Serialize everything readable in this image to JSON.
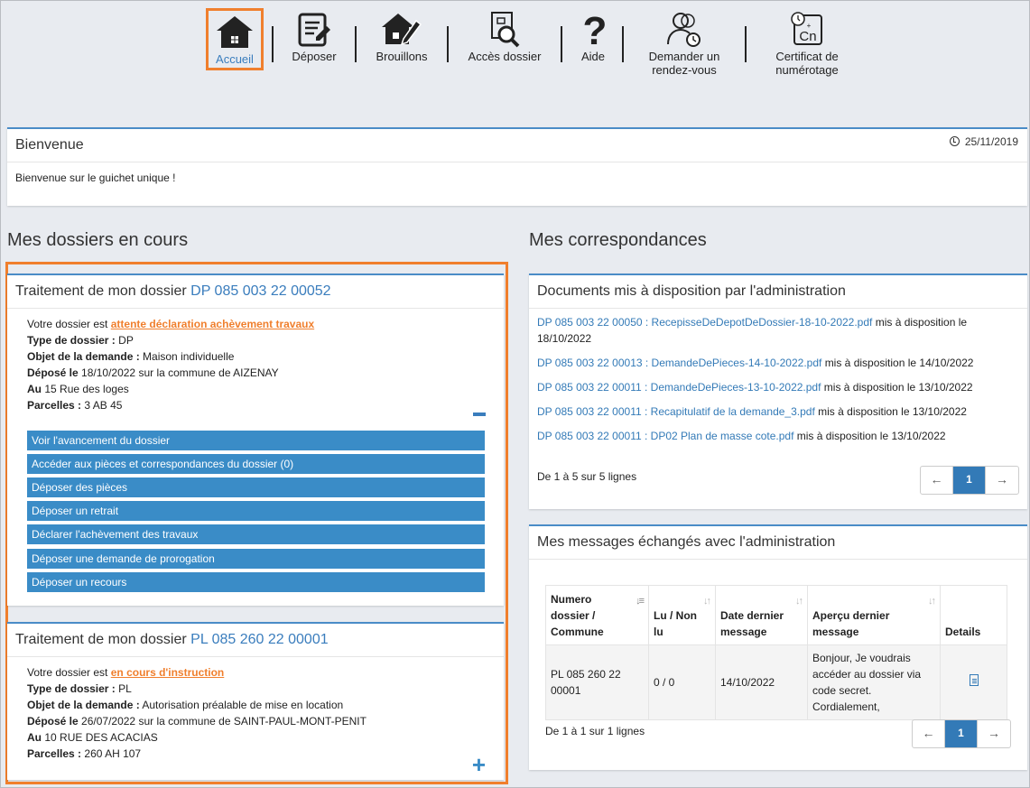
{
  "nav": {
    "accueil": "Accueil",
    "deposer": "Déposer",
    "brouillons": "Brouillons",
    "acces": "Accès dossier",
    "aide": "Aide",
    "rdv_1": "Demander un",
    "rdv_2": "rendez-vous",
    "cert_1": "Certificat de",
    "cert_2": "numérotage",
    "cert_icon_text": "Cn"
  },
  "welcome": {
    "title": "Bienvenue",
    "date": "25/11/2019",
    "message": "Bienvenue sur le guichet unique !"
  },
  "sections": {
    "dossiers": "Mes dossiers en cours",
    "correspondances": "Mes correspondances"
  },
  "dossier1": {
    "title_prefix": "Traitement de mon dossier",
    "id": "DP 085 003 22 00052",
    "status_prefix": "Votre dossier est",
    "status": "attente déclaration achèvement travaux",
    "type_label": "Type de dossier :",
    "type": "DP",
    "objet_label": "Objet de la demande :",
    "objet": "Maison individuelle",
    "depose_label": "Déposé le",
    "depose": "18/10/2022 sur la commune de AIZENAY",
    "au_label": "Au",
    "au": "15 Rue des loges",
    "parcelles_label": "Parcelles :",
    "parcelles": "3 AB 45",
    "actions": [
      "Voir l'avancement du dossier",
      "Accéder aux pièces et correspondances du dossier (0)",
      "Déposer des pièces",
      "Déposer un retrait",
      "Déclarer l'achèvement des travaux",
      "Déposer une demande de prorogation",
      "Déposer un recours"
    ]
  },
  "dossier2": {
    "title_prefix": "Traitement de mon dossier",
    "id": "PL 085 260 22 00001",
    "status_prefix": "Votre dossier est",
    "status": "en cours d'instruction",
    "type_label": "Type de dossier :",
    "type": "PL",
    "objet_label": "Objet de la demande :",
    "objet": "Autorisation préalable de mise en location",
    "depose_label": "Déposé le",
    "depose": "26/07/2022 sur la commune de SAINT-PAUL-MONT-PENIT",
    "au_label": "Au",
    "au": "10 RUE DES ACACIAS",
    "parcelles_label": "Parcelles :",
    "parcelles": "260 AH 107"
  },
  "documents": {
    "title": "Documents mis à disposition par l'administration",
    "items": [
      {
        "link": "DP 085 003 22 00050 : RecepisseDeDepotDeDossier-18-10-2022.pdf",
        "text": "mis à disposition le 18/10/2022"
      },
      {
        "link": "DP 085 003 22 00013 : DemandeDePieces-14-10-2022.pdf",
        "text": "mis à disposition le 14/10/2022"
      },
      {
        "link": "DP 085 003 22 00011 : DemandeDePieces-13-10-2022.pdf",
        "text": "mis à disposition le 13/10/2022"
      },
      {
        "link": "DP 085 003 22 00011 : Recapitulatif de la demande_3.pdf",
        "text": "mis à disposition le 13/10/2022"
      },
      {
        "link": "DP 085 003 22 00011 : DP02 Plan de masse cote.pdf",
        "text": "mis à disposition le 13/10/2022"
      }
    ],
    "footer": "De 1 à 5 sur 5 lignes",
    "pager": {
      "prev": "←",
      "page": "1",
      "next": "→"
    }
  },
  "messages": {
    "title": "Mes messages échangés avec l'administration",
    "columns": {
      "numero_1": "Numero",
      "numero_2": "dossier /",
      "numero_3": "Commune",
      "lu_1": "Lu / Non",
      "lu_2": "lu",
      "date_1": "Date dernier",
      "date_2": "message",
      "apercu_1": "Aperçu dernier",
      "apercu_2": "message",
      "details": "Details"
    },
    "row": {
      "numero_1": "PL 085 260 22",
      "numero_2": "00001",
      "lu": "0 / 0",
      "date": "14/10/2022",
      "apercu_1": "Bonjour, Je voudrais",
      "apercu_2": "accéder au dossier via",
      "apercu_3": "code secret.",
      "apercu_4": "Cordialement,"
    },
    "footer": "De 1 à 1 sur 1 lignes",
    "pager": {
      "prev": "←",
      "page": "1",
      "next": "→"
    }
  },
  "colors": {
    "accent": "#3a8cc7",
    "highlight": "#f07f2d",
    "link": "#337ab7"
  }
}
